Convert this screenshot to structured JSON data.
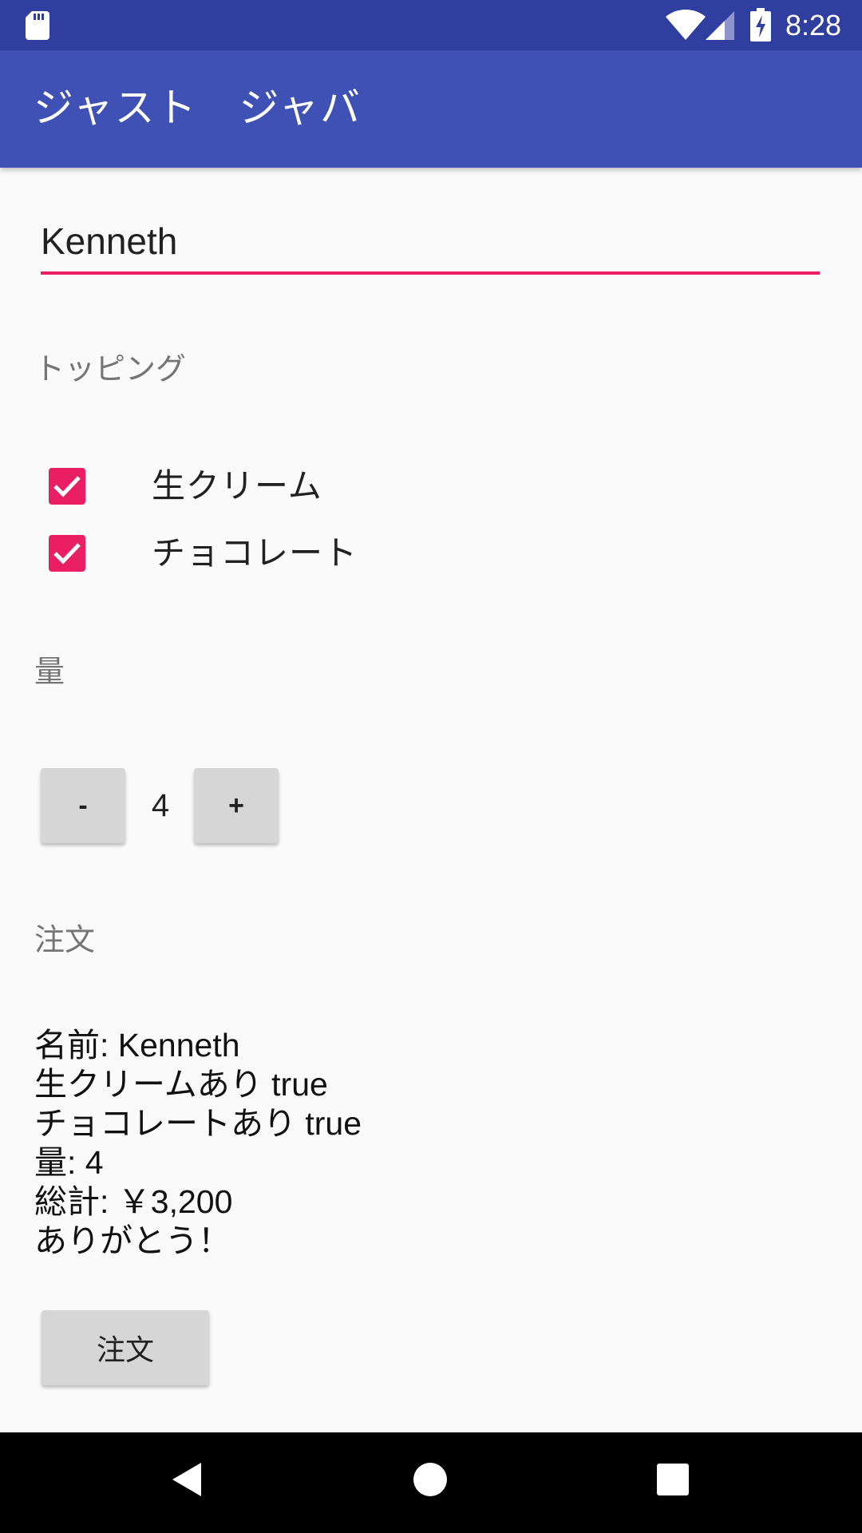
{
  "status_bar": {
    "time": "8:28"
  },
  "app_bar": {
    "title": "ジャスト　ジャバ"
  },
  "name_input": {
    "value": "Kenneth"
  },
  "toppings": {
    "label": "トッピング",
    "items": [
      {
        "label": "生クリーム",
        "checked": true
      },
      {
        "label": "チョコレート",
        "checked": true
      }
    ]
  },
  "quantity": {
    "label": "量",
    "minus_label": "-",
    "value": "4",
    "plus_label": "+"
  },
  "order": {
    "label": "注文",
    "summary_lines": [
      "名前: Kenneth",
      "生クリームあり true",
      "チョコレートあり true",
      "量: 4",
      "総計: ￥3,200",
      "ありがとう！"
    ],
    "button_label": "注文"
  },
  "colors": {
    "status_bar": "#303f9f",
    "app_bar": "#3f51b5",
    "accent": "#e91e63",
    "background": "#fafafa"
  }
}
